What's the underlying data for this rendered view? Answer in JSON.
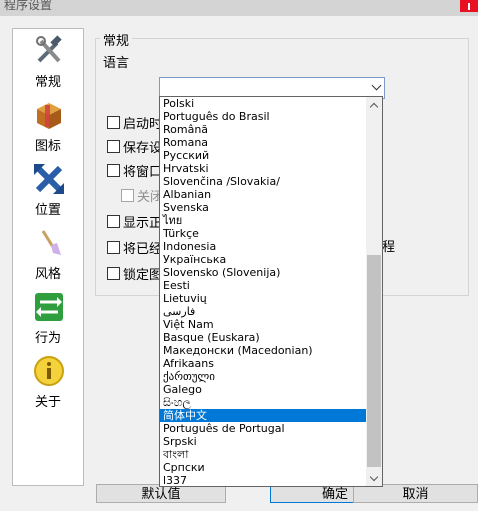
{
  "window": {
    "title": "程序设置"
  },
  "sidebar": {
    "items": [
      {
        "label": "常规",
        "icon": "tools-icon"
      },
      {
        "label": "图标",
        "icon": "package-icon"
      },
      {
        "label": "位置",
        "icon": "move-arrows-icon"
      },
      {
        "label": "风格",
        "icon": "brush-icon"
      },
      {
        "label": "行为",
        "icon": "switch-arrows-icon"
      },
      {
        "label": "关于",
        "icon": "info-icon"
      }
    ]
  },
  "general": {
    "group_title": "常规",
    "language_label": "语言",
    "language_value": "",
    "partial_label": "程"
  },
  "checkboxes": [
    {
      "label": "启动时"
    },
    {
      "label": "保存设"
    },
    {
      "label": "将窗口"
    },
    {
      "label": "关闭"
    },
    {
      "label": "显示正"
    },
    {
      "label": "将已经"
    },
    {
      "label": "锁定图"
    }
  ],
  "language_options": [
    "Polski",
    "Português do Brasil",
    "Română",
    "Romana",
    "Русский",
    "Hrvatski",
    "Slovenčina /Slovakia/",
    "Albanian",
    "Svenska",
    "ไทย",
    "Türkçe",
    "Indonesia",
    "Українська",
    "Slovensko (Slovenija)",
    "Eesti",
    "Lietuvių",
    "فارسی",
    "Việt Nam",
    "Basque (Euskara)",
    "Македонски (Macedonian)",
    "Afrikaans",
    "ქართული",
    "Galego",
    "සිංහල",
    "简体中文",
    "Português de Portugal",
    "Srpski",
    "বাংলা",
    "Српски",
    "l337"
  ],
  "selected_language": "简体中文",
  "buttons": {
    "default": "默认值",
    "ok": "确定",
    "cancel": "取消"
  }
}
